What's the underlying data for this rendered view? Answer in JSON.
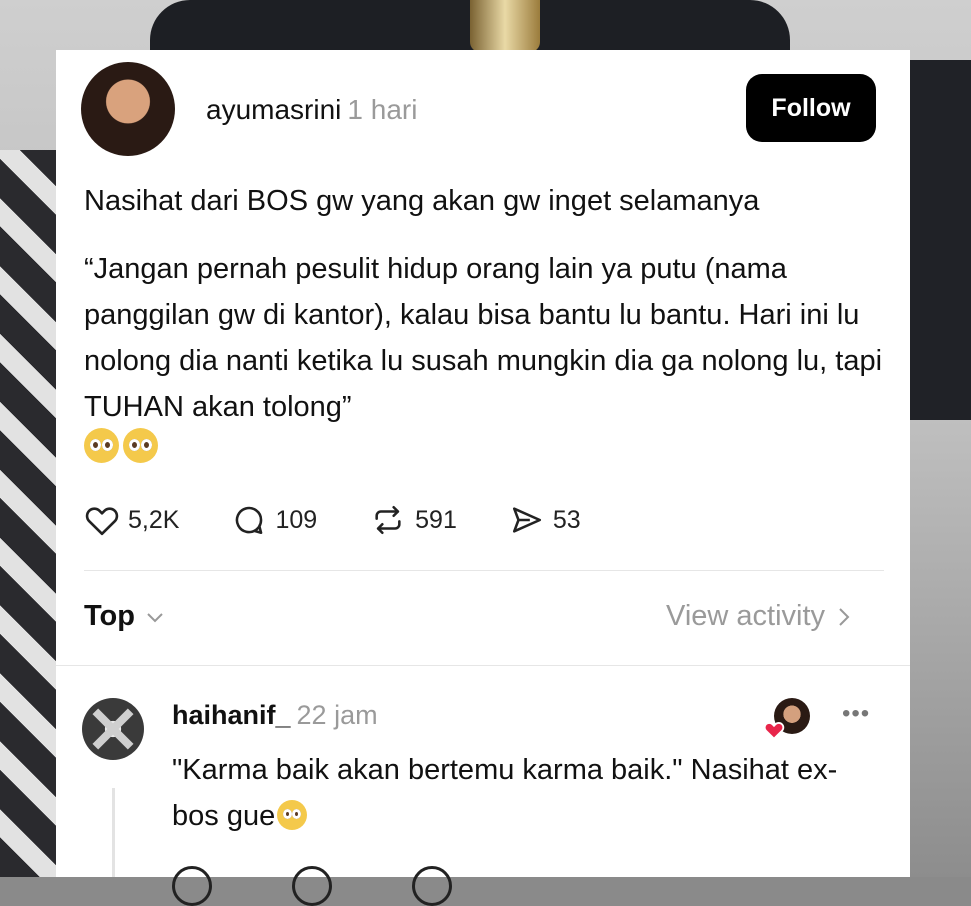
{
  "post": {
    "username": "ayumasrini",
    "time": "1 hari",
    "follow_label": "Follow",
    "paragraph1": "Nasihat dari BOS gw yang akan gw inget selamanya",
    "paragraph2": "“Jangan pernah pesulit hidup orang lain ya putu (nama panggilan gw di kantor), kalau bisa bantu lu bantu. Hari ini lu nolong dia nanti ketika lu susah mungkin dia ga nolong lu, tapi TUHAN akan tolong”",
    "emojis": [
      "pleading-face-emoji",
      "pleading-face-emoji"
    ],
    "likes": "5,2K",
    "replies": "109",
    "reposts": "591",
    "shares": "53"
  },
  "sort": {
    "label": "Top",
    "view_activity": "View activity"
  },
  "comment": {
    "username": "haihanif_",
    "time": "22 jam",
    "text": "\"Karma baik akan bertemu karma baik.\" Nasihat ex-bos gue",
    "emoji": "pleading-face-emoji",
    "more": "•••"
  },
  "colors": {
    "text": "#111111",
    "muted": "#9a9a9a",
    "button_bg": "#000000",
    "like_heart": "#e8254a"
  }
}
